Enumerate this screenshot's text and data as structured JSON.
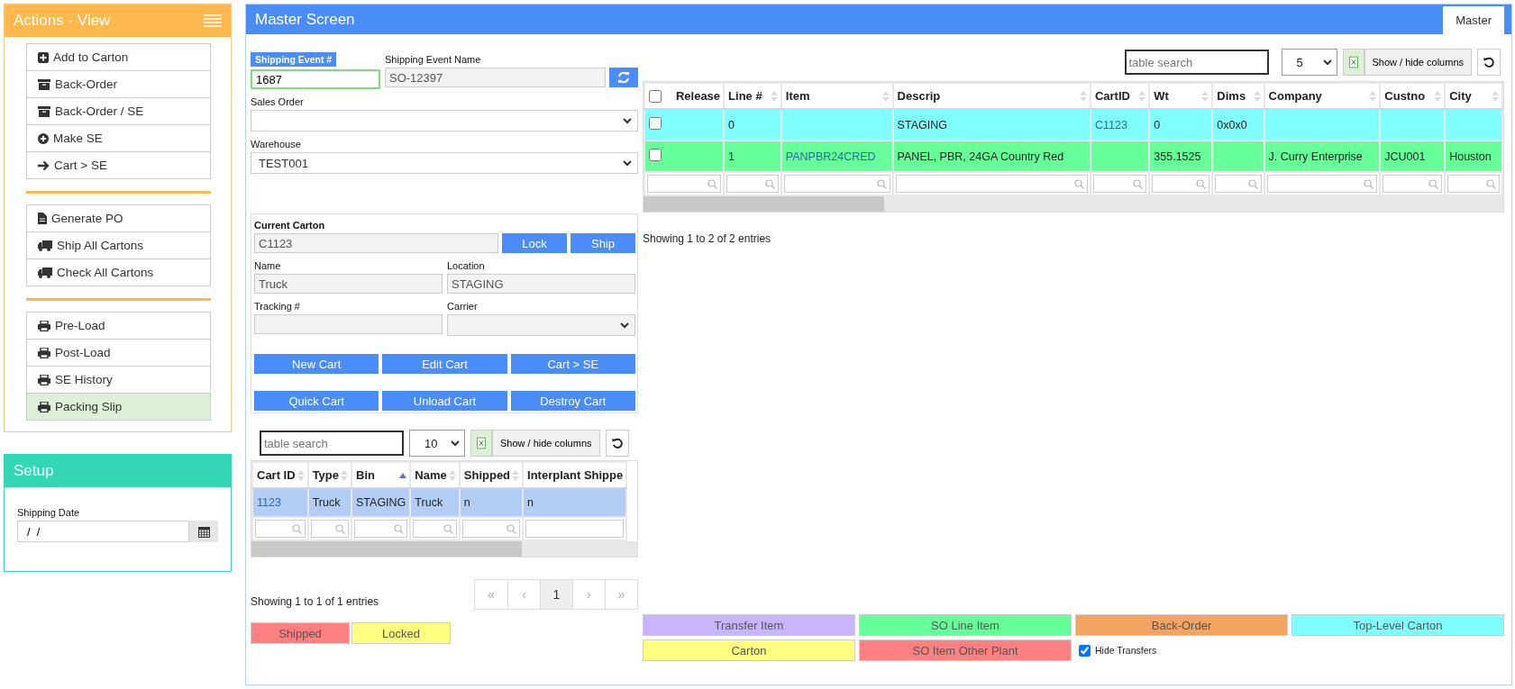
{
  "sidebar": {
    "title": "Actions - View",
    "groups": [
      [
        {
          "kind": "plus-square",
          "label": "Add to Carton",
          "selected": false
        },
        {
          "kind": "archive",
          "label": "Back-Order",
          "selected": false
        },
        {
          "kind": "archive",
          "label": "Back-Order / SE",
          "selected": false
        },
        {
          "kind": "plus-circle",
          "label": "Make SE",
          "selected": false
        },
        {
          "kind": "arrow",
          "label": "Cart > SE",
          "selected": false
        }
      ],
      [
        {
          "kind": "file",
          "label": "Generate PO",
          "selected": false
        },
        {
          "kind": "truck",
          "label": "Ship All Cartons",
          "selected": false
        },
        {
          "kind": "truck",
          "label": "Check All Cartons",
          "selected": false
        }
      ],
      [
        {
          "kind": "print",
          "label": "Pre-Load",
          "selected": false
        },
        {
          "kind": "print",
          "label": "Post-Load",
          "selected": false
        },
        {
          "kind": "print",
          "label": "SE History",
          "selected": false
        },
        {
          "kind": "print",
          "label": "Packing Slip",
          "selected": true
        }
      ]
    ]
  },
  "setup": {
    "title": "Setup",
    "date_label": "Shipping Date",
    "date_value": "/  /"
  },
  "master": {
    "title": "Master Screen",
    "tabs": [
      {
        "label": "Master",
        "selected": true
      }
    ],
    "form": {
      "event_label": "Shipping Event #",
      "event_value": "1687",
      "name_label": "Shipping Event Name",
      "name_value": "SO-12397",
      "sales_order_label": "Sales Order",
      "warehouse_label": "Warehouse",
      "warehouse_value": "TEST001"
    },
    "carton": {
      "title": "Current Carton",
      "value": "C1123",
      "buttons": [
        "Lock",
        "Ship"
      ],
      "name_label": "Name",
      "name_value": "Truck",
      "location_label": "Location",
      "location_value": "STAGING",
      "tracking_label": "Tracking #",
      "carrier_label": "Carrier",
      "actions": [
        "New Cart",
        "Edit Cart",
        "Cart > SE",
        "Quick Cart",
        "Unload Cart",
        "Destroy Cart"
      ]
    },
    "carts_table": {
      "search_placeholder": "table search",
      "page_size": "10",
      "columns_button": "Show / hide columns",
      "columns": [
        {
          "label": "Cart ID",
          "sorted": false,
          "kind": "link"
        },
        {
          "label": "Type",
          "sorted": false,
          "kind": "text"
        },
        {
          "label": "Bin",
          "sorted": true,
          "kind": "text"
        },
        {
          "label": "Name",
          "sorted": false,
          "kind": "text"
        },
        {
          "label": "Shipped",
          "sorted": false,
          "kind": "text"
        },
        {
          "label": "Interplant Shippe",
          "kind": "text"
        }
      ],
      "rows": [
        {
          "selected": true,
          "cells": [
            "1123",
            "Truck",
            "STAGING",
            "Truck",
            "n",
            "n"
          ]
        }
      ],
      "info": "Showing 1 to 1 of 1 entries",
      "pages": [
        {
          "label": "«",
          "selected": false
        },
        {
          "label": "‹",
          "selected": false
        },
        {
          "label": "1",
          "selected": true
        },
        {
          "label": "›",
          "selected": false
        },
        {
          "label": "»",
          "selected": false
        }
      ],
      "legend": [
        {
          "label": "Shipped",
          "color": "#ff8080"
        },
        {
          "label": "Locked",
          "color": "#ffff80"
        }
      ]
    },
    "items_table": {
      "search_placeholder": "table search",
      "page_size": "5",
      "columns_button": "Show / hide columns",
      "select_all_checked": false,
      "columns": [
        {
          "label": "Release",
          "kind": "checkbox"
        },
        {
          "label": "Line #",
          "kind": "text"
        },
        {
          "label": "Item",
          "kind": "link"
        },
        {
          "label": "Descrip",
          "kind": "text"
        },
        {
          "label": "CartID",
          "kind": "link"
        },
        {
          "label": "Wt",
          "kind": "text"
        },
        {
          "label": "Dims",
          "kind": "text"
        },
        {
          "label": "Company",
          "kind": "text"
        },
        {
          "label": "Custno",
          "kind": "text"
        },
        {
          "label": "City",
          "kind": "text"
        }
      ],
      "rows": [
        {
          "color": "#80ffff",
          "checked": false,
          "cells": [
            null,
            "0",
            null,
            "STAGING",
            "C1123",
            "0",
            "0x0x0",
            null,
            null,
            null
          ]
        },
        {
          "color": "#66ff99",
          "checked": false,
          "cells": [
            null,
            "1",
            "PANPBR24CRED",
            "PANEL, PBR, 24GA Country Red",
            null,
            "355.1525",
            null,
            "J. Curry Enterprise",
            "JCU001",
            "Houston"
          ]
        }
      ],
      "info": "Showing 1 to 2 of 2 entries",
      "legend": [
        {
          "label": "Transfer Item",
          "color": "#c8b4ff"
        },
        {
          "label": "SO Line Item",
          "color": "#66ff99"
        },
        {
          "label": "Back-Order",
          "color": "#f4a460"
        },
        {
          "label": "Top-Level Carton",
          "color": "#80ffff"
        },
        {
          "label": "Carton",
          "color": "#ffff80"
        },
        {
          "label": "SO Item Other Plant",
          "color": "#ff8080"
        }
      ],
      "hide_transfers": {
        "label": "Hide Transfers",
        "checked": true
      }
    }
  }
}
